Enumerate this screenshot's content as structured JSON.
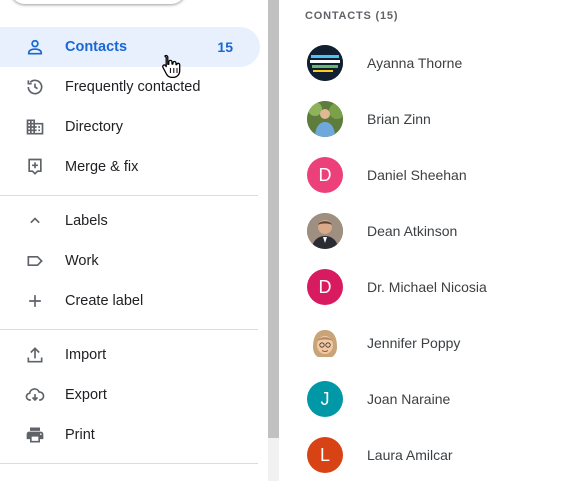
{
  "nav": {
    "contacts_label": "Contacts",
    "contacts_count": "15",
    "frequently_label": "Frequently contacted",
    "directory_label": "Directory",
    "merge_label": "Merge & fix",
    "labels_label": "Labels",
    "work_label": "Work",
    "create_label": "Create label",
    "import_label": "Import",
    "export_label": "Export",
    "print_label": "Print"
  },
  "list": {
    "header": "CONTACTS (15)",
    "contacts": [
      {
        "name": "Ayanna Thorne",
        "avatar": "photo"
      },
      {
        "name": "Brian Zinn",
        "avatar": "photo"
      },
      {
        "name": "Daniel Sheehan",
        "avatar": "D",
        "color": "#ec407a"
      },
      {
        "name": "Dean Atkinson",
        "avatar": "photo"
      },
      {
        "name": "Dr. Michael Nicosia",
        "avatar": "D",
        "color": "#d81b60"
      },
      {
        "name": "Jennifer Poppy",
        "avatar": "photo"
      },
      {
        "name": "Joan Naraine",
        "avatar": "J",
        "color": "#0097a7"
      },
      {
        "name": "Laura Amilcar",
        "avatar": "L",
        "color": "#d84315"
      }
    ]
  },
  "colors": {
    "accent": "#1967d2",
    "active_bg": "#e8f0fe"
  }
}
